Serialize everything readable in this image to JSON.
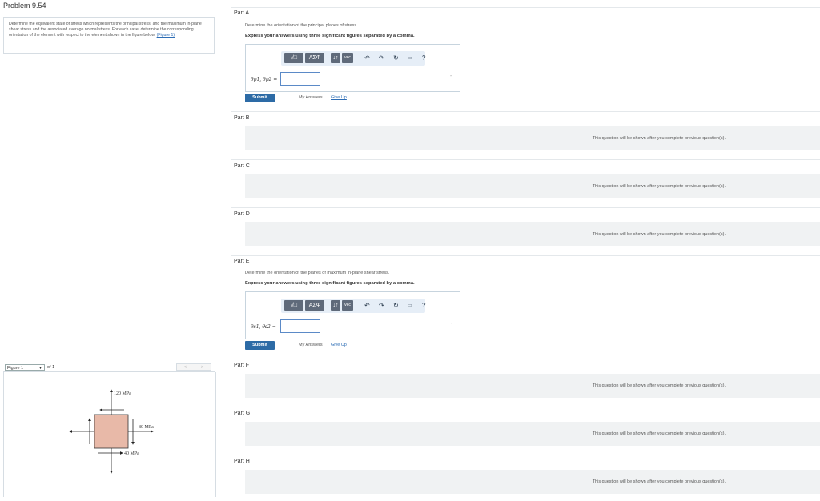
{
  "problem": {
    "title": "Problem 9.54",
    "text": "Determine the equivalent state of stress which represents the principal stress, and the maximum in-plane shear stress and the associated average normal stress. For each case, determine the corresponding orientation of the element with respect to the element shown in the figure below.",
    "figure_link": "(Figure 1)"
  },
  "figure": {
    "selector": "Figure 1",
    "of_label": "of 1",
    "nav_prev": "<",
    "nav_next": ">",
    "top_stress": "120 MPa",
    "right_stress": "80 MPa",
    "bottom_stress": "40 MPa"
  },
  "toolbar": {
    "template_label": "√□",
    "greek_label": "ΑΣΦ",
    "arrows_label": "↓↑",
    "vec_label": "vec",
    "undo_icon": "undo-icon",
    "redo_icon": "redo-icon",
    "reset_icon": "reset-icon",
    "keyboard_icon": "keyboard-icon",
    "help_label": "?"
  },
  "parts": {
    "a": {
      "title": "Part A",
      "description": "Determine the orientation of the principal planes of stress.",
      "instruction": "Express your answers using three significant figures separated by a comma.",
      "var_label": "θp1, θp2 =",
      "value": "",
      "submit": "Submit",
      "my_answers": "My Answers",
      "give_up": "Give Up"
    },
    "b": {
      "title": "Part B",
      "locked_msg": "This question will be shown after you complete previous question(s)."
    },
    "c": {
      "title": "Part C",
      "locked_msg": "This question will be shown after you complete previous question(s)."
    },
    "d": {
      "title": "Part D",
      "locked_msg": "This question will be shown after you complete previous question(s)."
    },
    "e": {
      "title": "Part E",
      "description": "Determine the orientation of the planes of maximum in-plane shear stress.",
      "instruction": "Express your answers using three significant figures separated by a comma.",
      "var_label": "θs1, θs2 =",
      "value": "",
      "submit": "Submit",
      "my_answers": "My Answers",
      "give_up": "Give Up"
    },
    "f": {
      "title": "Part F",
      "locked_msg": "This question will be shown after you complete previous question(s)."
    },
    "g": {
      "title": "Part G",
      "locked_msg": "This question will be shown after you complete previous question(s)."
    },
    "h": {
      "title": "Part H",
      "locked_msg": "This question will be shown after you complete previous question(s)."
    }
  },
  "colors": {
    "element_fill": "#e8b9a8",
    "submit_bg": "#2d6ba6",
    "toolbar_bg": "#e6eef7"
  }
}
